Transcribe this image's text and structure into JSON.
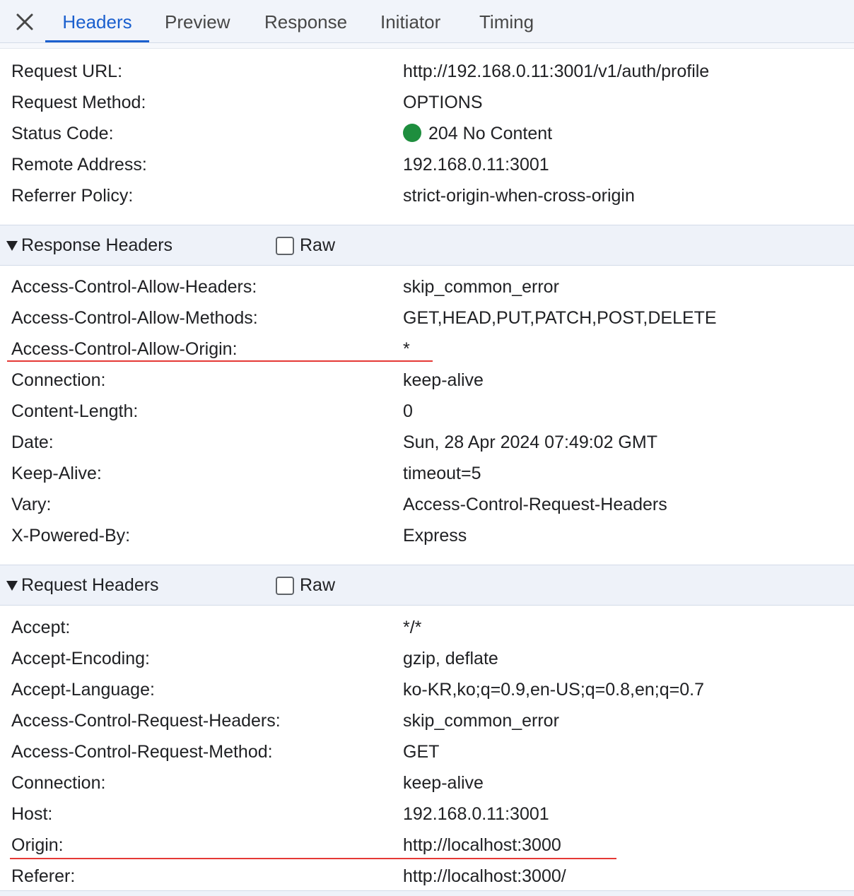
{
  "tabs": [
    {
      "label": "Headers",
      "active": true
    },
    {
      "label": "Preview",
      "active": false
    },
    {
      "label": "Response",
      "active": false
    },
    {
      "label": "Initiator",
      "active": false
    },
    {
      "label": "Timing",
      "active": false
    }
  ],
  "close_icon": "close-icon",
  "general": [
    {
      "key": "Request URL:",
      "value": "http://192.168.0.11:3001/v1/auth/profile"
    },
    {
      "key": "Request Method:",
      "value": "OPTIONS"
    },
    {
      "key": "Status Code:",
      "value": "204 No Content",
      "status_color": "#1e8e3e"
    },
    {
      "key": "Remote Address:",
      "value": "192.168.0.11:3001"
    },
    {
      "key": "Referrer Policy:",
      "value": "strict-origin-when-cross-origin"
    }
  ],
  "response_headers": {
    "title": "Response Headers",
    "raw_label": "Raw",
    "raw_checked": false,
    "rows": [
      {
        "key": "Access-Control-Allow-Headers:",
        "value": "skip_common_error"
      },
      {
        "key": "Access-Control-Allow-Methods:",
        "value": "GET,HEAD,PUT,PATCH,POST,DELETE"
      },
      {
        "key": "Access-Control-Allow-Origin:",
        "value": "*"
      },
      {
        "key": "Connection:",
        "value": "keep-alive"
      },
      {
        "key": "Content-Length:",
        "value": "0"
      },
      {
        "key": "Date:",
        "value": "Sun, 28 Apr 2024 07:49:02 GMT"
      },
      {
        "key": "Keep-Alive:",
        "value": "timeout=5"
      },
      {
        "key": "Vary:",
        "value": "Access-Control-Request-Headers"
      },
      {
        "key": "X-Powered-By:",
        "value": "Express"
      }
    ]
  },
  "request_headers": {
    "title": "Request Headers",
    "raw_label": "Raw",
    "raw_checked": false,
    "rows": [
      {
        "key": "Accept:",
        "value": "*/*"
      },
      {
        "key": "Accept-Encoding:",
        "value": "gzip, deflate"
      },
      {
        "key": "Accept-Language:",
        "value": "ko-KR,ko;q=0.9,en-US;q=0.8,en;q=0.7"
      },
      {
        "key": "Access-Control-Request-Headers:",
        "value": "skip_common_error"
      },
      {
        "key": "Access-Control-Request-Method:",
        "value": "GET"
      },
      {
        "key": "Connection:",
        "value": "keep-alive"
      },
      {
        "key": "Host:",
        "value": "192.168.0.11:3001"
      },
      {
        "key": "Origin:",
        "value": "http://localhost:3000"
      },
      {
        "key": "Referer:",
        "value": "http://localhost:3000/"
      }
    ]
  },
  "annotation_color": "#e53935"
}
